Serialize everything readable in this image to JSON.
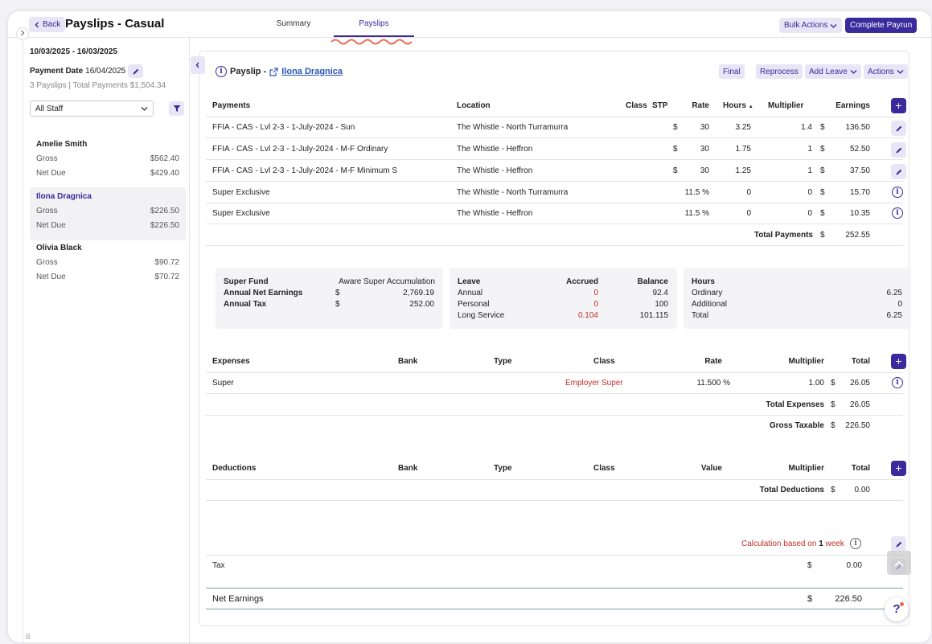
{
  "header": {
    "back_label": "Back",
    "title": "Payslips - Casual",
    "tabs": [
      "Summary",
      "Payslips"
    ],
    "bulk_actions": "Bulk Actions",
    "complete_payrun": "Complete Payrun"
  },
  "sidebar": {
    "dates": "10/03/2025 - 16/03/2025",
    "payment_date_label": "Payment Date",
    "payment_date": "16/04/2025",
    "summary": "3 Payslips | Total Payments $1,504.34",
    "staff_filter": "All Staff",
    "employees": [
      {
        "name": "Amelie Smith",
        "gross_label": "Gross",
        "gross": "$562.40",
        "net_label": "Net Due",
        "net": "$429.40"
      },
      {
        "name": "Ilona Dragnica",
        "gross_label": "Gross",
        "gross": "$226.50",
        "net_label": "Net Due",
        "net": "$226.50"
      },
      {
        "name": "Olivia Black",
        "gross_label": "Gross",
        "gross": "$90.72",
        "net_label": "Net Due",
        "net": "$70.72"
      }
    ],
    "footer": "B"
  },
  "payslip": {
    "label": "Payslip -",
    "employee": "Ilona Dragnica",
    "actions": {
      "final": "Final",
      "reprocess": "Reprocess",
      "add_leave": "Add Leave",
      "actions": "Actions"
    }
  },
  "payments": {
    "headers": {
      "payments": "Payments",
      "location": "Location",
      "class": "Class",
      "stp": "STP",
      "rate": "Rate",
      "hours": "Hours",
      "multiplier": "Multiplier",
      "earnings": "Earnings"
    },
    "rows": [
      {
        "name": "FFIA - CAS - Lvl 2-3 - 1-July-2024 - Sun",
        "location": "The Whistle - North Turramurra",
        "cur": "$",
        "rate": "30",
        "hours": "3.25",
        "multiplier": "1.4",
        "ecur": "$",
        "earnings": "136.50"
      },
      {
        "name": "FFIA - CAS - Lvl 2-3 - 1-July-2024 - M-F Ordinary",
        "location": "The Whistle - Heffron",
        "cur": "$",
        "rate": "30",
        "hours": "1.75",
        "multiplier": "1",
        "ecur": "$",
        "earnings": "52.50"
      },
      {
        "name": "FFIA - CAS - Lvl 2-3 - 1-July-2024 - M-F Minimum S",
        "location": "The Whistle - Heffron",
        "cur": "$",
        "rate": "30",
        "hours": "1.25",
        "multiplier": "1",
        "ecur": "$",
        "earnings": "37.50"
      },
      {
        "name": "Super Exclusive",
        "location": "The Whistle - North Turramurra",
        "cur": "",
        "rate": "11.5 %",
        "hours": "0",
        "multiplier": "0",
        "ecur": "$",
        "earnings": "15.70"
      },
      {
        "name": "Super Exclusive",
        "location": "The Whistle - Heffron",
        "cur": "",
        "rate": "11.5 %",
        "hours": "0",
        "multiplier": "0",
        "ecur": "$",
        "earnings": "10.35"
      }
    ],
    "total_label": "Total Payments",
    "total_cur": "$",
    "total": "252.55"
  },
  "super_box": {
    "fund_label": "Super Fund",
    "fund": "Aware Super Accumulation",
    "net_label": "Annual Net Earnings",
    "net_cur": "$",
    "net": "2,769.19",
    "tax_label": "Annual Tax",
    "tax_cur": "$",
    "tax": "252.00"
  },
  "leave_box": {
    "h_leave": "Leave",
    "h_accrued": "Accrued",
    "h_balance": "Balance",
    "rows": [
      {
        "type": "Annual",
        "accrued": "0",
        "balance": "92.4"
      },
      {
        "type": "Personal",
        "accrued": "0",
        "balance": "100"
      },
      {
        "type": "Long Service",
        "accrued": "0.104",
        "balance": "101.115"
      }
    ]
  },
  "hours_box": {
    "h_hours": "Hours",
    "rows": [
      {
        "label": "Ordinary",
        "value": "6.25"
      },
      {
        "label": "Additional",
        "value": "0"
      },
      {
        "label": "Total",
        "value": "6.25"
      }
    ]
  },
  "expenses": {
    "headers": {
      "expenses": "Expenses",
      "bank": "Bank",
      "type": "Type",
      "class": "Class",
      "rate": "Rate",
      "multiplier": "Multiplier",
      "total": "Total"
    },
    "row": {
      "name": "Super",
      "class": "Employer Super",
      "rate": "11.500 %",
      "multiplier": "1.00",
      "cur": "$",
      "total": "26.05"
    },
    "total_label": "Total Expenses",
    "total_cur": "$",
    "total": "26.05",
    "gross_label": "Gross Taxable",
    "gross_cur": "$",
    "gross": "226.50"
  },
  "deductions": {
    "headers": {
      "deductions": "Deductions",
      "bank": "Bank",
      "type": "Type",
      "class": "Class",
      "value": "Value",
      "multiplier": "Multiplier",
      "total": "Total"
    },
    "total_label": "Total Deductions",
    "total_cur": "$",
    "total": "0.00"
  },
  "tax": {
    "calc_prefix": "Calculation based on",
    "calc_num": "1",
    "calc_unit": "week",
    "label": "Tax",
    "cur": "$",
    "value": "0.00"
  },
  "net": {
    "label": "Net Earnings",
    "cur": "$",
    "value": "226.50"
  },
  "help": "?",
  "colors": {
    "accent": "#3a2a9c",
    "negative": "#c0302a"
  }
}
